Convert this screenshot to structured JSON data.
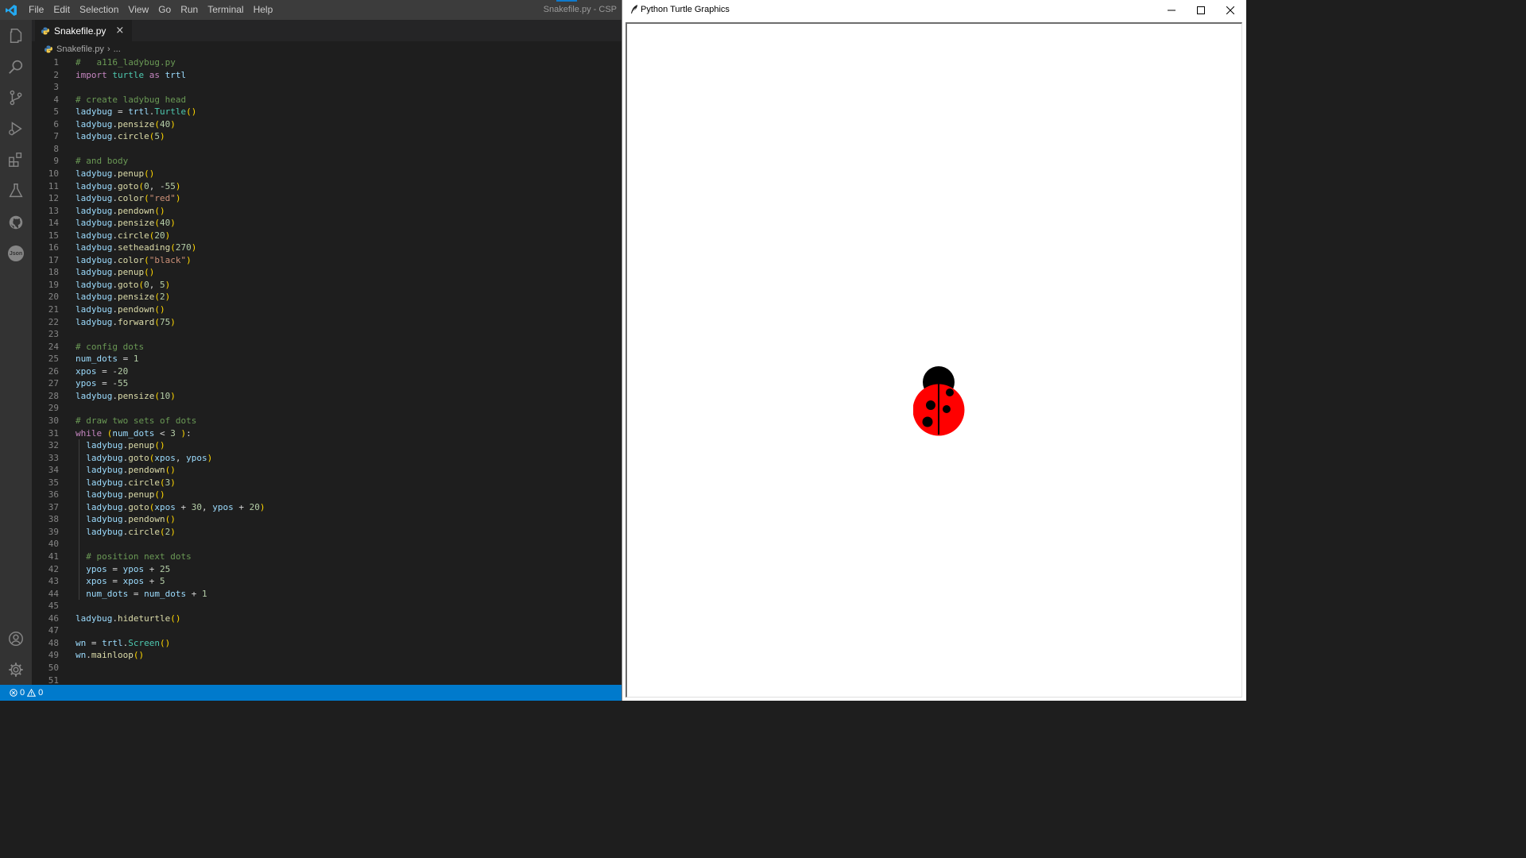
{
  "vscode": {
    "menu": [
      "File",
      "Edit",
      "Selection",
      "View",
      "Go",
      "Run",
      "Terminal",
      "Help"
    ],
    "window_title": "Snakefile.py - CSP",
    "activity_icons": [
      "explorer-icon",
      "search-icon",
      "source-control-icon",
      "run-debug-icon",
      "extensions-icon",
      "testing-icon",
      "github-icon",
      "json-icon"
    ],
    "json_icon_label": "Json",
    "bottom_icons": [
      "accounts-icon",
      "settings-gear-icon"
    ],
    "tab": {
      "label": "Snakefile.py",
      "close": "×"
    },
    "breadcrumb": {
      "file": "Snakefile.py",
      "separator": "›",
      "rest": "..."
    },
    "code_lines": [
      "#   a116_ladybug.py",
      "import turtle as trtl",
      "",
      "# create ladybug head",
      "ladybug = trtl.Turtle()",
      "ladybug.pensize(40)",
      "ladybug.circle(5)",
      "",
      "# and body",
      "ladybug.penup()",
      "ladybug.goto(0, -55)",
      "ladybug.color(\"red\")",
      "ladybug.pendown()",
      "ladybug.pensize(40)",
      "ladybug.circle(20)",
      "ladybug.setheading(270)",
      "ladybug.color(\"black\")",
      "ladybug.penup()",
      "ladybug.goto(0, 5)",
      "ladybug.pensize(2)",
      "ladybug.pendown()",
      "ladybug.forward(75)",
      "",
      "# config dots",
      "num_dots = 1",
      "xpos = -20",
      "ypos = -55",
      "ladybug.pensize(10)",
      "",
      "# draw two sets of dots",
      "while (num_dots < 3 ):",
      "  ladybug.penup()",
      "  ladybug.goto(xpos, ypos)",
      "  ladybug.pendown()",
      "  ladybug.circle(3)",
      "  ladybug.penup()",
      "  ladybug.goto(xpos + 30, ypos + 20)",
      "  ladybug.pendown()",
      "  ladybug.circle(2)",
      "",
      "  # position next dots",
      "  ypos = ypos + 25",
      "  xpos = xpos + 5",
      "  num_dots = num_dots + 1",
      "",
      "ladybug.hideturtle()",
      "",
      "wn = trtl.Screen()",
      "wn.mainloop()",
      "",
      ""
    ],
    "status": {
      "errors": "0",
      "warnings": "0"
    },
    "colors": {
      "accent": "#007acc",
      "titlebar": "#3c3c3c",
      "editor_bg": "#1e1e1e"
    }
  },
  "turtle_window": {
    "title": "Python Turtle Graphics",
    "controls": [
      "minimize",
      "maximize",
      "close"
    ],
    "drawing": {
      "head_color": "#000000",
      "body_color": "#ff0000",
      "dot_color": "#000000"
    }
  }
}
